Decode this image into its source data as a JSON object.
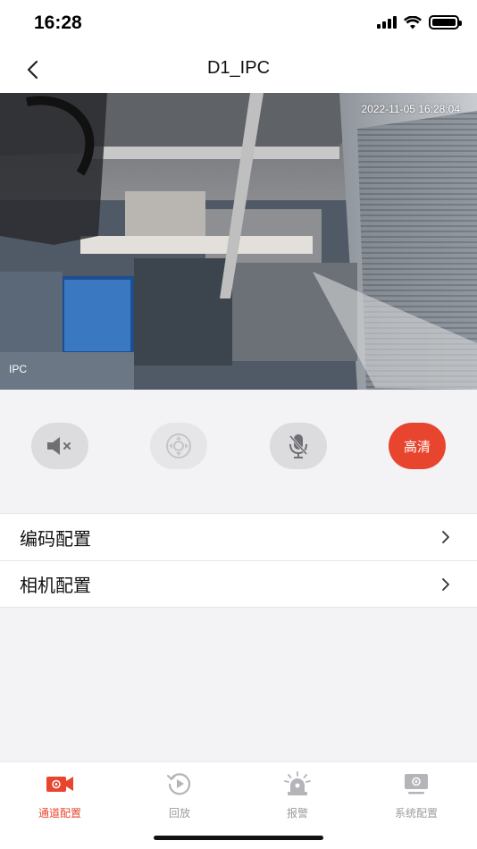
{
  "status_bar": {
    "time": "16:28"
  },
  "header": {
    "title": "D1_IPC"
  },
  "video": {
    "timestamp": "2022-11-05 16:28:04",
    "label": "IPC"
  },
  "controls": {
    "quality_label": "高清",
    "accent": "#e8452e"
  },
  "menu": {
    "items": [
      {
        "label": "编码配置"
      },
      {
        "label": "相机配置"
      }
    ]
  },
  "tabs": [
    {
      "label": "通道配置",
      "icon": "camera-settings-icon",
      "active": true
    },
    {
      "label": "回放",
      "icon": "playback-icon",
      "active": false
    },
    {
      "label": "报警",
      "icon": "alarm-icon",
      "active": false
    },
    {
      "label": "系统配置",
      "icon": "system-settings-icon",
      "active": false
    }
  ]
}
